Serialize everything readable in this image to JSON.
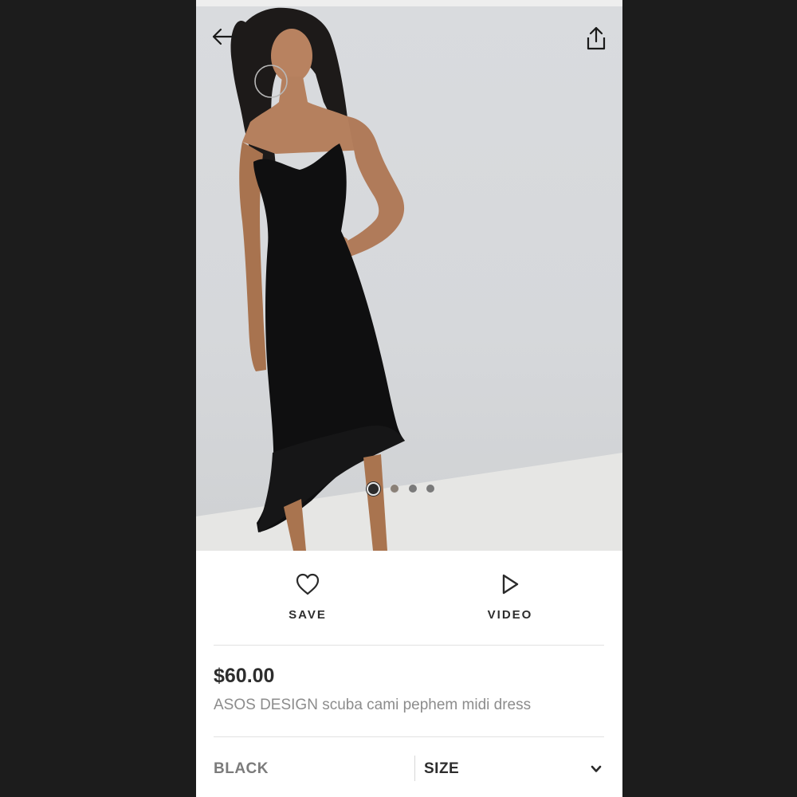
{
  "product": {
    "image_alt": "Model wearing black scuba cami peplum hem midi dress",
    "carousel": {
      "total": 4,
      "active": 1
    },
    "price": "$60.00",
    "title": "ASOS DESIGN scuba cami pephem midi dress",
    "colour": "BLACK",
    "size_label": "SIZE"
  },
  "actions": {
    "save_label": "SAVE",
    "video_label": "VIDEO"
  },
  "icons": {
    "back": "back-arrow-icon",
    "share": "share-icon",
    "save": "heart-icon",
    "video": "play-icon",
    "size_dropdown": "chevron-down-icon"
  },
  "colors": {
    "background": "#1c1c1c",
    "text_primary": "#2d2d2d",
    "text_secondary": "#8c8c8c"
  }
}
